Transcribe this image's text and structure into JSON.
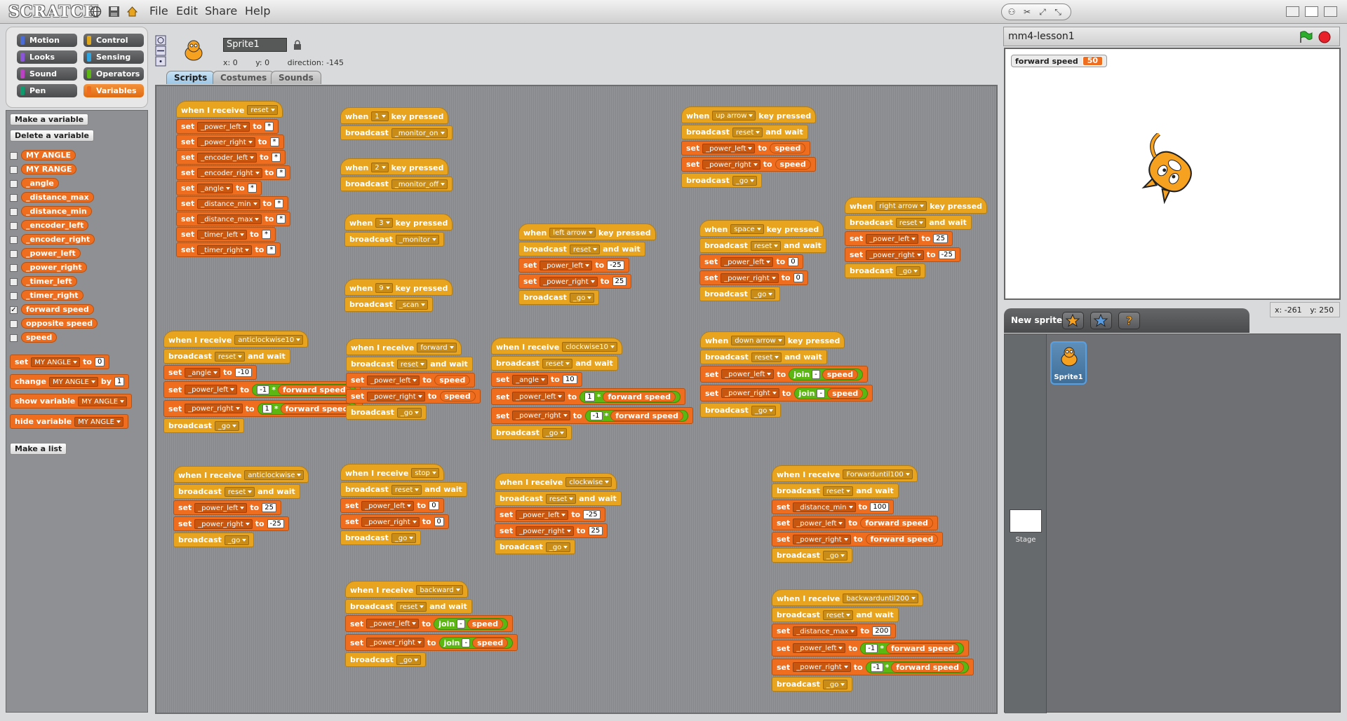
{
  "menu": {
    "logo": "SCRATCH",
    "file": "File",
    "edit": "Edit",
    "share": "Share",
    "help": "Help"
  },
  "categories": [
    "Motion",
    "Control",
    "Looks",
    "Sensing",
    "Sound",
    "Operators",
    "Pen",
    "Variables"
  ],
  "palette": {
    "make_variable": "Make a variable",
    "delete_variable": "Delete a variable",
    "variables": [
      {
        "name": "MY ANGLE",
        "checked": ""
      },
      {
        "name": "MY RANGE",
        "checked": ""
      },
      {
        "name": "_angle",
        "checked": ""
      },
      {
        "name": "_distance_max",
        "checked": ""
      },
      {
        "name": "_distance_min",
        "checked": ""
      },
      {
        "name": "_encoder_left",
        "checked": ""
      },
      {
        "name": "_encoder_right",
        "checked": ""
      },
      {
        "name": "_power_left",
        "checked": ""
      },
      {
        "name": "_power_right",
        "checked": ""
      },
      {
        "name": "_timer_left",
        "checked": ""
      },
      {
        "name": "_timer_right",
        "checked": ""
      },
      {
        "name": "forward speed",
        "checked": "✓"
      },
      {
        "name": "opposite speed",
        "checked": ""
      },
      {
        "name": "speed",
        "checked": ""
      }
    ],
    "set_block": {
      "kw": "set",
      "var": "MY ANGLE",
      "to": "to",
      "val": "0"
    },
    "change_block": {
      "kw": "change",
      "var": "MY ANGLE",
      "by": "by",
      "val": "1"
    },
    "show_block": {
      "kw": "show variable",
      "var": "MY ANGLE"
    },
    "hide_block": {
      "kw": "hide variable",
      "var": "MY ANGLE"
    },
    "make_list": "Make a list"
  },
  "sprite": {
    "name": "Sprite1",
    "x_label": "x:",
    "x": "0",
    "y_label": "y:",
    "y": "0",
    "direction_label": "direction:",
    "direction": "-145"
  },
  "tabs": [
    "Scripts",
    "Costumes",
    "Sounds"
  ],
  "stage": {
    "title": "mm4-lesson1",
    "monitor_label": "forward speed",
    "monitor_value": "50"
  },
  "newsprite": {
    "label": "New sprite:"
  },
  "coords": {
    "x_label": "x:",
    "x": "-261",
    "y_label": "y:",
    "y": "250"
  },
  "sprites": {
    "sprite1": "Sprite1",
    "stage": "Stage"
  },
  "colors": {
    "events": "#e8a31f",
    "variables": "#ef6d1e",
    "operators": "#5cb712"
  },
  "kw": {
    "when_receive": "when I receive",
    "when": "when",
    "key_pressed": "key pressed",
    "broadcast": "broadcast",
    "and_wait": "and wait",
    "set": "set",
    "to": "to",
    "join": "join",
    "times": "*",
    "minus": "-",
    "speed": "speed",
    "forward_speed": "forward speed"
  },
  "scripts": {
    "s1": {
      "msg": "reset",
      "rows": [
        {
          "var": "_power_left",
          "val": "*"
        },
        {
          "var": "_power_right",
          "val": "*"
        },
        {
          "var": "_encoder_left",
          "val": "*"
        },
        {
          "var": "_encoder_right",
          "val": "*"
        },
        {
          "var": "_angle",
          "val": "*"
        },
        {
          "var": "_distance_min",
          "val": "*"
        },
        {
          "var": "_distance_max",
          "val": "*"
        },
        {
          "var": "_timer_left",
          "val": "*"
        },
        {
          "var": "_timer_right",
          "val": "*"
        }
      ]
    },
    "s2": {
      "key": "1",
      "msg": "_monitor_on"
    },
    "s3": {
      "key": "2",
      "msg": "_monitor_off"
    },
    "s4": {
      "key": "3",
      "msg": "_monitor"
    },
    "s5": {
      "key": "9",
      "msg": "_scan"
    },
    "s6": {
      "key": "up arrow",
      "msg1": "reset",
      "v1": "_power_left",
      "v2": "_power_right",
      "msg2": "_go"
    },
    "s7": {
      "key": "left arrow",
      "msg1": "reset",
      "v1": "_power_left",
      "n1": "-25",
      "v2": "_power_right",
      "n2": "25",
      "msg2": "_go"
    },
    "s8": {
      "key": "space",
      "msg1": "reset",
      "v1": "_power_left",
      "n1": "0",
      "v2": "_power_right",
      "n2": "0",
      "msg2": "_go"
    },
    "s9": {
      "key": "right arrow",
      "msg1": "reset",
      "v1": "_power_left",
      "n1": "25",
      "v2": "_power_right",
      "n2": "-25",
      "msg2": "_go"
    },
    "s10": {
      "msg": "anticlockwise10",
      "msg1": "reset",
      "v0": "_angle",
      "n0": "-10",
      "v1": "_power_left",
      "k1": "-1",
      "v2": "_power_right",
      "k2": "1",
      "msg2": "_go"
    },
    "s11": {
      "msg": "forward",
      "msg1": "reset",
      "v1": "_power_left",
      "v2": "_power_right",
      "msg2": "_go"
    },
    "s12": {
      "msg": "clockwise10",
      "msg1": "reset",
      "v0": "_angle",
      "n0": "10",
      "v1": "_power_left",
      "k1": "1",
      "v2": "_power_right",
      "k2": "-1",
      "msg2": "_go"
    },
    "s13": {
      "key": "down arrow",
      "msg1": "reset",
      "v1": "_power_left",
      "v2": "_power_right",
      "msg2": "_go"
    },
    "s14": {
      "msg": "anticlockwise",
      "msg1": "reset",
      "v1": "_power_left",
      "n1": "25",
      "v2": "_power_right",
      "n2": "-25",
      "msg2": "_go"
    },
    "s15": {
      "msg": "stop",
      "msg1": "reset",
      "v1": "_power_left",
      "n1": "0",
      "v2": "_power_right",
      "n2": "0",
      "msg2": "_go"
    },
    "s16": {
      "msg": "clockwise",
      "msg1": "reset",
      "v1": "_power_left",
      "n1": "-25",
      "v2": "_power_right",
      "n2": "25",
      "msg2": "_go"
    },
    "s17": {
      "msg": "Forwarduntil100",
      "msg1": "reset",
      "v0": "_distance_min",
      "n0": "100",
      "v1": "_power_left",
      "v2": "_power_right",
      "msg2": "_go"
    },
    "s18": {
      "msg": "backward",
      "msg1": "reset",
      "v1": "_power_left",
      "v2": "_power_right",
      "msg2": "_go"
    },
    "s19": {
      "msg": "backwarduntil200",
      "msg1": "reset",
      "v0": "_distance_max",
      "n0": "200",
      "v1": "_power_left",
      "k1": "-1",
      "v2": "_power_right",
      "k2": "-1",
      "msg2": "_go"
    }
  }
}
